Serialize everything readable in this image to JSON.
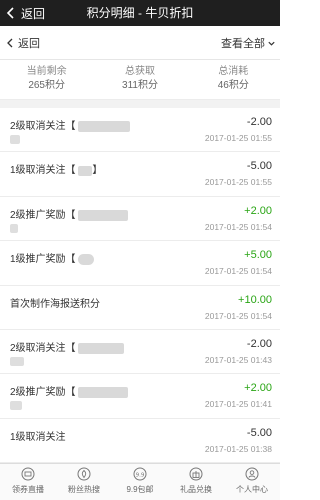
{
  "titlebar": {
    "back_label": "返回",
    "title": "积分明细 - 牛贝折扣"
  },
  "subbar": {
    "back_label": "返回",
    "view_all_label": "查看全部"
  },
  "summary": [
    {
      "label": "当前剩余",
      "value": "265积分"
    },
    {
      "label": "总获取",
      "value": "311积分"
    },
    {
      "label": "总消耗",
      "value": "46积分"
    }
  ],
  "records": [
    {
      "desc": "2级取消关注【",
      "amount": "-2.00",
      "time": "2017-01-25 01:55",
      "type": "neg"
    },
    {
      "desc": "1级取消关注【",
      "amount": "-5.00",
      "time": "2017-01-25 01:55",
      "type": "neg"
    },
    {
      "desc": "2级推广奖励【",
      "amount": "+2.00",
      "time": "2017-01-25 01:54",
      "type": "pos"
    },
    {
      "desc": "1级推广奖励【",
      "amount": "+5.00",
      "time": "2017-01-25 01:54",
      "type": "pos"
    },
    {
      "desc": "首次制作海报送积分",
      "amount": "+10.00",
      "time": "2017-01-25 01:54",
      "type": "pos"
    },
    {
      "desc": "2级取消关注【",
      "amount": "-2.00",
      "time": "2017-01-25 01:43",
      "type": "neg"
    },
    {
      "desc": "2级推广奖励【",
      "amount": "+2.00",
      "time": "2017-01-25 01:41",
      "type": "pos"
    },
    {
      "desc": "1级取消关注",
      "amount": "-5.00",
      "time": "2017-01-25 01:38",
      "type": "neg"
    }
  ],
  "tabbar": [
    {
      "label": "领券直播",
      "icon": "coupon-icon"
    },
    {
      "label": "粉丝热搜",
      "icon": "hot-search-icon"
    },
    {
      "label": "9.9包邮",
      "icon": "shipping-icon"
    },
    {
      "label": "礼品兑换",
      "icon": "gift-icon"
    },
    {
      "label": "个人中心",
      "icon": "user-icon"
    }
  ],
  "colors": {
    "positive": "#2aa515",
    "titlebar": "#1f1f1f"
  }
}
